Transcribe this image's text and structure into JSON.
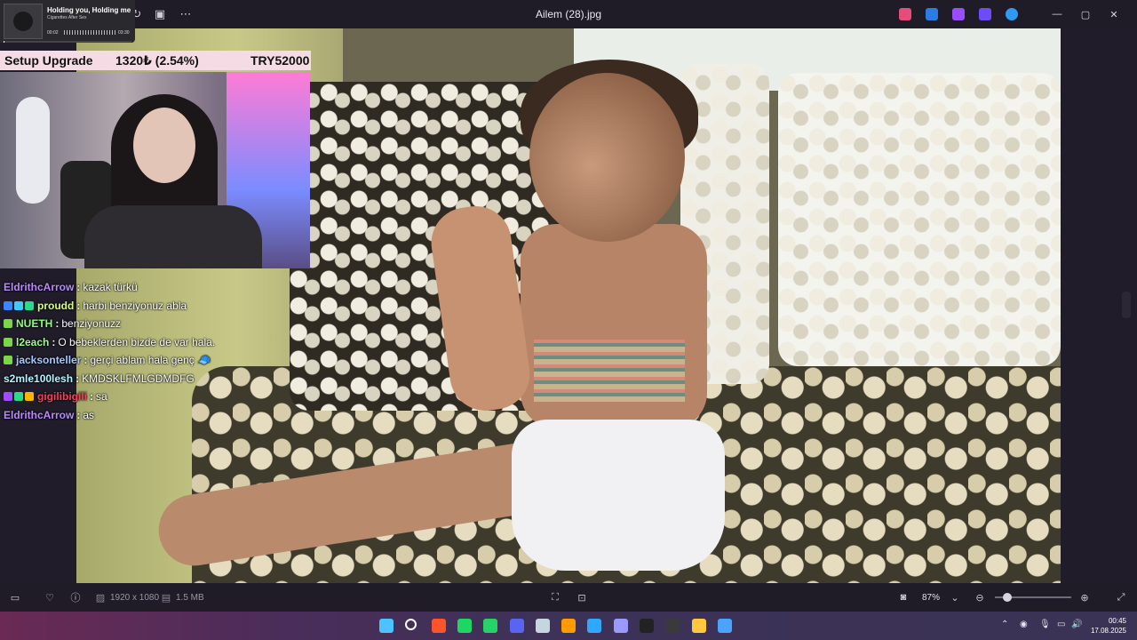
{
  "window": {
    "title": "Ailem (28).jpg",
    "more_label": "⋯"
  },
  "music_widget": {
    "song": "Holding you, Holding me",
    "artist": "Cigarettes After Sex",
    "elapsed": "00:02",
    "duration": "03:30",
    "progress_fraction": 0.01
  },
  "goal_bar": {
    "name": "Setup Upgrade",
    "progress": "1320₺ (2.54%)",
    "target": "TRY52000"
  },
  "chat": [
    {
      "user": "EldrithcArrow",
      "color": "#b98bff",
      "badges": [],
      "message": "kazak türkü"
    },
    {
      "user": "proudd",
      "color": "#d6ff7a",
      "badges": [
        "#3a86ff",
        "#46c6ff",
        "#2bd98a"
      ],
      "message": "harbi benziyonuz abla"
    },
    {
      "user": "NUETH",
      "color": "#8aff7a",
      "badges": [
        "#7bd64a"
      ],
      "message": "benziyonuzz"
    },
    {
      "user": "l2each",
      "color": "#9dff8a",
      "badges": [
        "#7bd64a"
      ],
      "message": "O bebeklerden bizde de var hala."
    },
    {
      "user": "jacksonteller",
      "color": "#a7c8ff",
      "badges": [
        "#7bd64a"
      ],
      "message": "gerçi ablam hala genç 🧢"
    },
    {
      "user": "s2mle100lesh",
      "color": "#b6f3ff",
      "badges": [],
      "message": "KMDSKLFMLGDMDFG"
    },
    {
      "user": "gigilibigili",
      "color": "#ff3a5c",
      "badges": [
        "#a04bff",
        "#2bd98a",
        "#ffb400"
      ],
      "message": "sa"
    },
    {
      "user": "EldrithcArrow",
      "color": "#b98bff",
      "badges": [],
      "message": "as"
    }
  ],
  "statusbar": {
    "resolution": "1920 x 1080",
    "filesize": "1.5 MB",
    "zoom": "87%"
  },
  "taskbar": {
    "time": "00:45",
    "date": "17.08.2025",
    "pinned_apps": [
      {
        "name": "start-icon",
        "color": "#4cc2ff"
      },
      {
        "name": "search-icon",
        "color": "#ffffff"
      },
      {
        "name": "brave-icon",
        "color": "#fb542b"
      },
      {
        "name": "spotify-icon",
        "color": "#1ed760"
      },
      {
        "name": "whatsapp-icon",
        "color": "#25d366"
      },
      {
        "name": "discord-icon",
        "color": "#5865f2"
      },
      {
        "name": "steam-icon",
        "color": "#c7d5e0"
      },
      {
        "name": "illustrator-icon",
        "color": "#ff9a00"
      },
      {
        "name": "photoshop-icon",
        "color": "#31a8ff"
      },
      {
        "name": "premiere-icon",
        "color": "#9999ff"
      },
      {
        "name": "capcut-icon",
        "color": "#222222"
      },
      {
        "name": "obs-icon",
        "color": "#3a3a3a"
      },
      {
        "name": "file-explorer-icon",
        "color": "#ffc83d"
      },
      {
        "name": "photos-icon",
        "color": "#4aa3ff"
      }
    ]
  },
  "colors": {
    "viewer_bg": "#201c29",
    "goal_bg": "#f4dbe4"
  }
}
